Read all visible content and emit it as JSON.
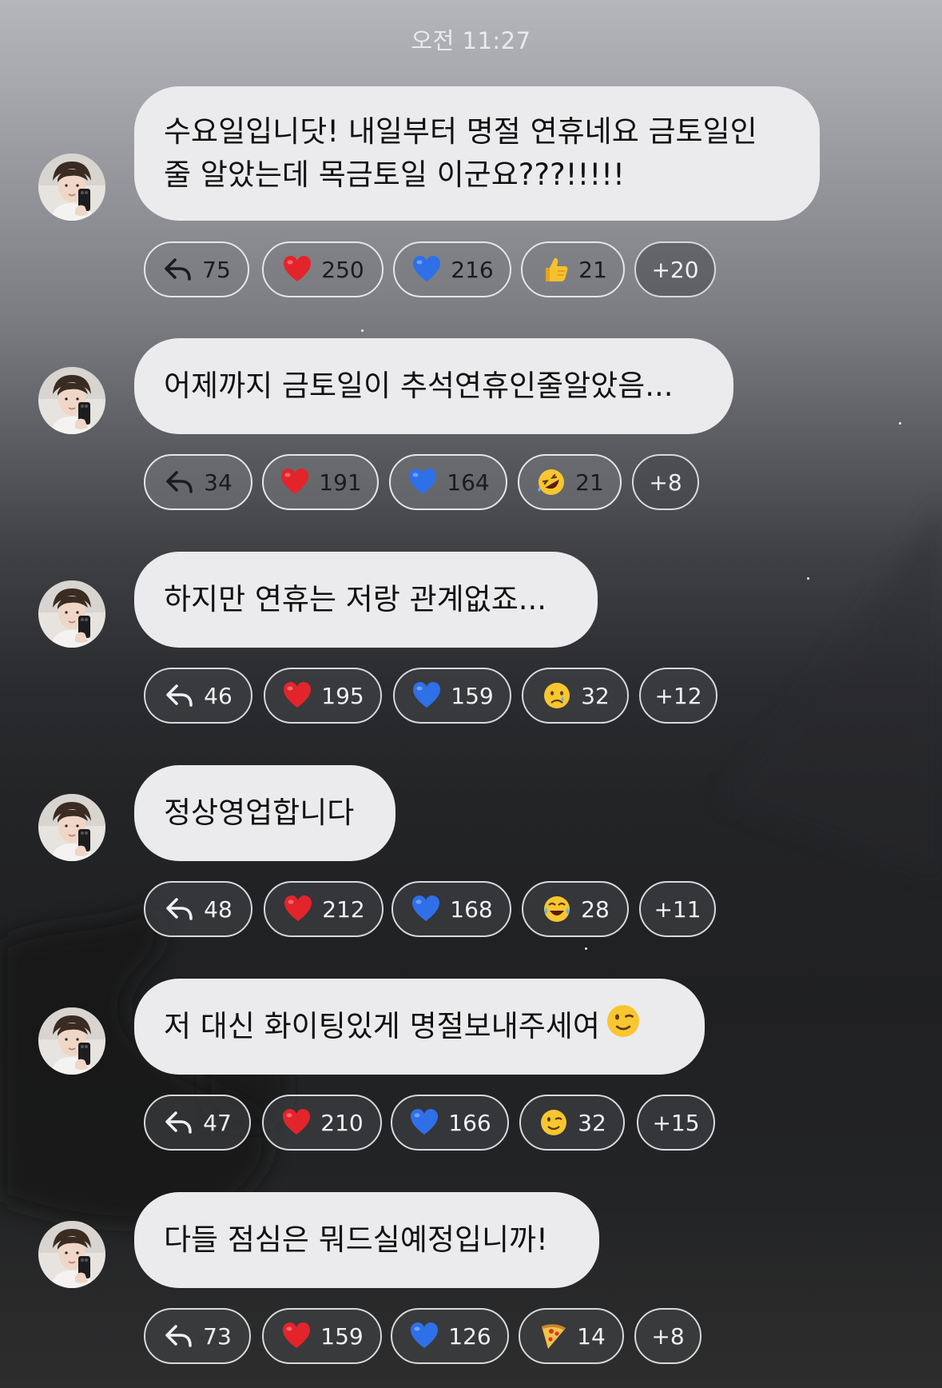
{
  "timestamp": "오전 11:27",
  "messages": [
    {
      "text": "수요일입니닷! 내일부터 명절 연휴네요 금토일인\n줄 알았는데 목금토일 이군요???!!!!!",
      "reactions": [
        {
          "icon": "reply-arrow-icon",
          "count": "75"
        },
        {
          "icon": "red-heart-icon",
          "count": "250"
        },
        {
          "icon": "blue-heart-icon",
          "count": "216"
        },
        {
          "icon": "thumbs-up-icon",
          "count": "21"
        },
        {
          "icon": "",
          "count": "+20"
        }
      ]
    },
    {
      "text": "어제까지 금토일이 추석연휴인줄알았음...",
      "reactions": [
        {
          "icon": "reply-arrow-icon",
          "count": "34"
        },
        {
          "icon": "red-heart-icon",
          "count": "191"
        },
        {
          "icon": "blue-heart-icon",
          "count": "164"
        },
        {
          "icon": "rofl-face-icon",
          "count": "21"
        },
        {
          "icon": "",
          "count": "+8"
        }
      ]
    },
    {
      "text": "하지만 연휴는 저랑 관계없죠...",
      "reactions": [
        {
          "icon": "reply-arrow-icon",
          "count": "46"
        },
        {
          "icon": "red-heart-icon",
          "count": "195"
        },
        {
          "icon": "blue-heart-icon",
          "count": "159"
        },
        {
          "icon": "crying-face-icon",
          "count": "32"
        },
        {
          "icon": "",
          "count": "+12"
        }
      ]
    },
    {
      "text": "정상영업합니다",
      "reactions": [
        {
          "icon": "reply-arrow-icon",
          "count": "48"
        },
        {
          "icon": "red-heart-icon",
          "count": "212"
        },
        {
          "icon": "blue-heart-icon",
          "count": "168"
        },
        {
          "icon": "tears-of-joy-face-icon",
          "count": "28"
        },
        {
          "icon": "",
          "count": "+11"
        }
      ]
    },
    {
      "text": "저 대신 화이팅있게 명절보내주세여",
      "emoji": "winking-face-icon",
      "reactions": [
        {
          "icon": "reply-arrow-icon",
          "count": "47"
        },
        {
          "icon": "red-heart-icon",
          "count": "210"
        },
        {
          "icon": "blue-heart-icon",
          "count": "166"
        },
        {
          "icon": "winking-face-icon",
          "count": "32"
        },
        {
          "icon": "",
          "count": "+15"
        }
      ]
    },
    {
      "text": "다들 점심은 뭐드실예정입니까!",
      "reactions": [
        {
          "icon": "reply-arrow-icon",
          "count": "73"
        },
        {
          "icon": "red-heart-icon",
          "count": "159"
        },
        {
          "icon": "blue-heart-icon",
          "count": "126"
        },
        {
          "icon": "pizza-icon",
          "count": "14"
        },
        {
          "icon": "",
          "count": "+8"
        }
      ]
    }
  ]
}
